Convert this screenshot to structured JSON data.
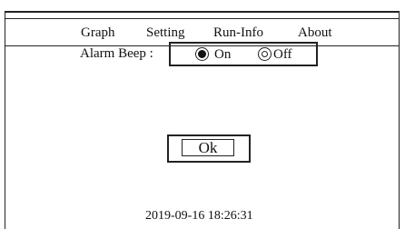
{
  "menu": {
    "items": [
      {
        "label": "Graph"
      },
      {
        "label": "Setting"
      },
      {
        "label": "Run-Info"
      },
      {
        "label": "About"
      }
    ]
  },
  "settings": {
    "alarm_beep_label": "Alarm Beep :",
    "options": [
      {
        "label": "On",
        "selected": true
      },
      {
        "label": "Off",
        "selected": false
      }
    ]
  },
  "actions": {
    "ok_label": "Ok"
  },
  "status": {
    "datetime": "2019-09-16 18:26:31"
  }
}
